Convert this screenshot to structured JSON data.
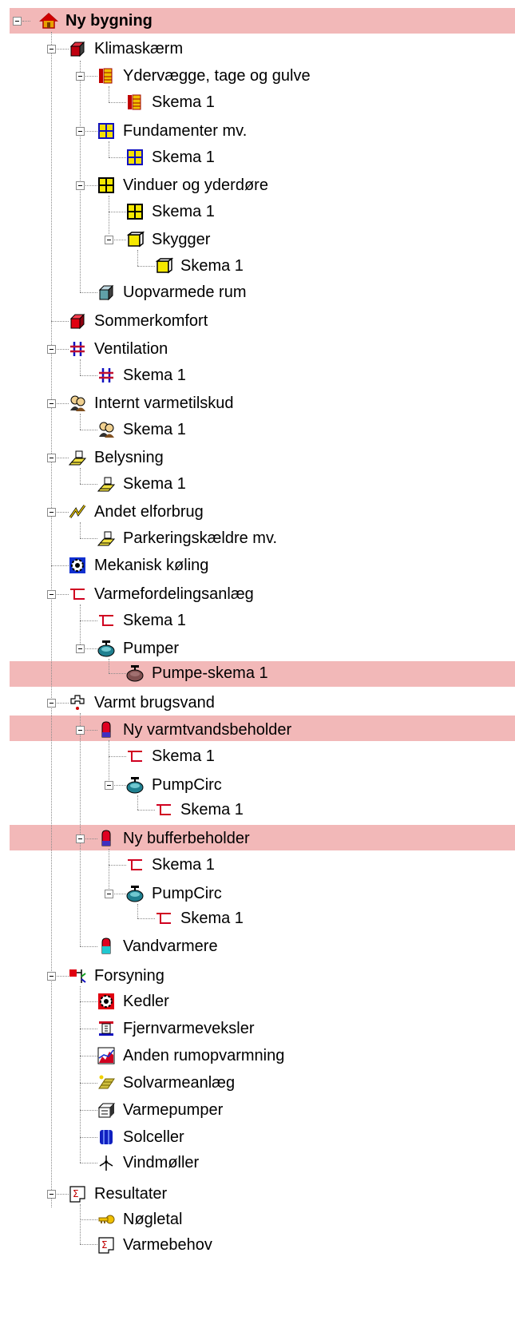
{
  "tree": {
    "root_label": "Ny bygning",
    "klimaskaerm": "Klimaskærm",
    "ydervaegge": "Ydervægge, tage og gulve",
    "schema1": "Skema 1",
    "fundamenter": "Fundamenter mv.",
    "vinduer": "Vinduer og yderdøre",
    "skygger": "Skygger",
    "uopvarmede": "Uopvarmede rum",
    "sommerkomfort": "Sommerkomfort",
    "ventilation": "Ventilation",
    "internt": "Internt varmetilskud",
    "belysning": "Belysning",
    "andet": "Andet elforbrug",
    "parkering": "Parkeringskældre mv.",
    "mekanisk": "Mekanisk køling",
    "varmefordeling": "Varmefordelingsanlæg",
    "pumper": "Pumper",
    "pumpe_skema": "Pumpe-skema 1",
    "varmt_brugsvand": "Varmt brugsvand",
    "ny_varmtvand": "Ny varmtvandsbeholder",
    "pumpcirc": "PumpCirc",
    "ny_buffer": "Ny bufferbeholder",
    "vandvarmere": "Vandvarmere",
    "forsyning": "Forsyning",
    "kedler": "Kedler",
    "fjernvarme": "Fjernvarmeveksler",
    "anden_rum": "Anden rumopvarmning",
    "solvarme": "Solvarmeanlæg",
    "varmepumper": "Varmepumper",
    "solceller": "Solceller",
    "vindmoller": "Vindmøller",
    "resultater": "Resultater",
    "noegletal": "Nøgletal",
    "varmebehov": "Varmebehov"
  },
  "colors": {
    "highlight": "#f2b8b8",
    "connector": "#8a8a8a"
  }
}
